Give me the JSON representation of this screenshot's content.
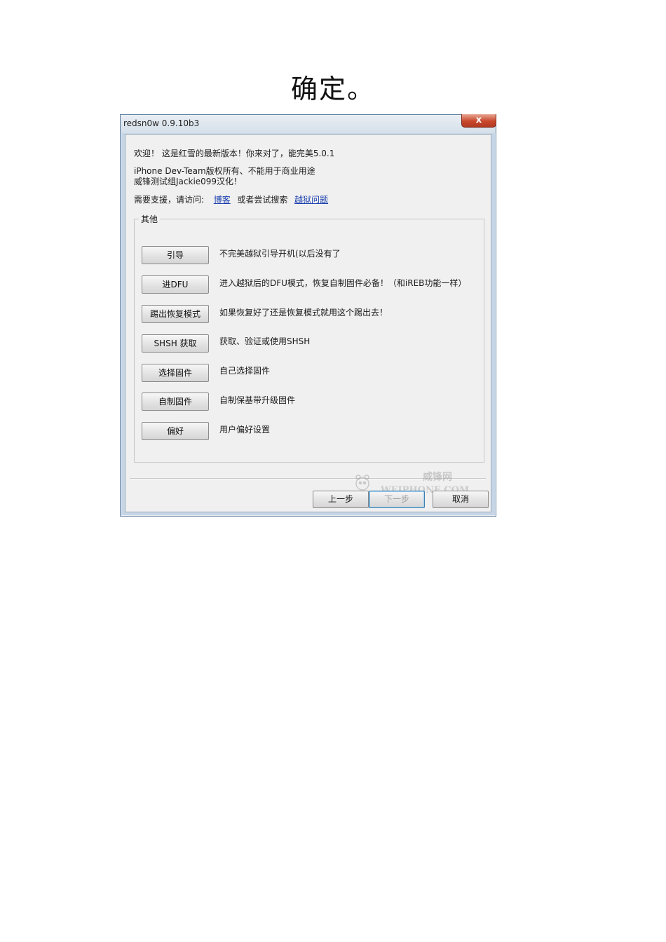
{
  "document": {
    "heading": "确定。"
  },
  "window": {
    "title": "redsn0w 0.9.10b3",
    "close_label": "x",
    "info": {
      "welcome": "欢迎！ 这是红雪的最新版本！你来对了，能完美5.0.1",
      "copyright": "iPhone Dev-Team版权所有、不能用于商业用途",
      "translation": "威锋测试组Jackie099汉化！",
      "support_prefix": "需要支援，请访问:",
      "blog_link": "博客",
      "support_middle": "或者尝试搜索",
      "jailbreak_link": "越狱问题"
    },
    "group": {
      "legend": "其他",
      "options": [
        {
          "button": "引导",
          "description": "不完美越狱引导开机(以后没有了"
        },
        {
          "button": "进DFU",
          "description": "进入越狱后的DFU模式，恢复自制固件必备！（和iREB功能一样）"
        },
        {
          "button": "踢出恢复模式",
          "description": "如果恢复好了还是恢复模式就用这个踢出去！"
        },
        {
          "button": "SHSH 获取",
          "description": "获取、验证或使用SHSH"
        },
        {
          "button": "选择固件",
          "description": "自己选择固件"
        },
        {
          "button": "自制固件",
          "description": "自制保基带升级固件"
        },
        {
          "button": "偏好",
          "description": "用户偏好设置"
        }
      ]
    },
    "watermark": {
      "cn": "威锋网",
      "en": "WEIPHONE.COM"
    },
    "nav": {
      "back_label": "上一步",
      "next_label": "下一步",
      "cancel_label": "取消"
    }
  },
  "colors": {
    "link": "#1a3fae",
    "close_button": "#c8482c",
    "window_frame": "#c7d6e6",
    "dialog_background": "#f0f0f0"
  }
}
